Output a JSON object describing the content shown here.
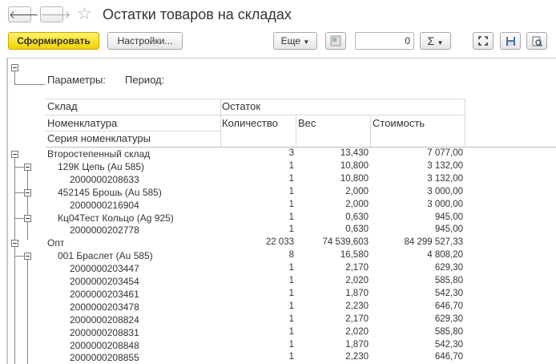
{
  "window": {
    "title": "Остатки товаров на складах",
    "back_icon": "arrow-left-icon",
    "forward_icon": "arrow-right-icon",
    "favorite_icon": "star-icon"
  },
  "toolbar": {
    "generate_label": "Сформировать",
    "settings_label": "Настройки...",
    "more_label": "Еще",
    "sum_value": "0",
    "sum_symbol": "Σ"
  },
  "report": {
    "params_label": "Параметры:",
    "period_label": "Период:",
    "headers": {
      "warehouse": "Склад",
      "remainder": "Остаток",
      "nomenclature": "Номенклатура",
      "quantity": "Количество",
      "weight": "Вес",
      "cost": "Стоимость",
      "series": "Серия номенклатуры"
    },
    "rows": [
      {
        "name": "Второстепенный склад",
        "qty": "3",
        "weight": "13,430",
        "cost": "7 077,00"
      },
      {
        "name": "129К Цепь (Au 585)",
        "qty": "1",
        "weight": "10,800",
        "cost": "3 132,00"
      },
      {
        "name": "2000000208633",
        "qty": "1",
        "weight": "10,800",
        "cost": "3 132,00"
      },
      {
        "name": "452145 Брошь (Au 585)",
        "qty": "1",
        "weight": "2,000",
        "cost": "3 000,00"
      },
      {
        "name": "2000000216904",
        "qty": "1",
        "weight": "2,000",
        "cost": "3 000,00"
      },
      {
        "name": "Кц04Тест Кольцо (Ag 925)",
        "qty": "1",
        "weight": "0,630",
        "cost": "945,00"
      },
      {
        "name": "2000000202778",
        "qty": "1",
        "weight": "0,630",
        "cost": "945,00"
      },
      {
        "name": "Опт",
        "qty": "22 033",
        "weight": "74 539,603",
        "cost": "84 299 527,33"
      },
      {
        "name": "001 Браслет (Au 585)",
        "qty": "8",
        "weight": "16,580",
        "cost": "4 808,20"
      },
      {
        "name": "2000000203447",
        "qty": "1",
        "weight": "2,170",
        "cost": "629,30"
      },
      {
        "name": "2000000203454",
        "qty": "1",
        "weight": "2,020",
        "cost": "585,80"
      },
      {
        "name": "2000000203461",
        "qty": "1",
        "weight": "1,870",
        "cost": "542,30"
      },
      {
        "name": "2000000203478",
        "qty": "1",
        "weight": "2,230",
        "cost": "646,70"
      },
      {
        "name": "2000000208824",
        "qty": "1",
        "weight": "2,170",
        "cost": "629,30"
      },
      {
        "name": "2000000208831",
        "qty": "1",
        "weight": "2,020",
        "cost": "585,80"
      },
      {
        "name": "2000000208848",
        "qty": "1",
        "weight": "1,870",
        "cost": "542,30"
      },
      {
        "name": "2000000208855",
        "qty": "1",
        "weight": "2,230",
        "cost": "646,70"
      }
    ]
  }
}
